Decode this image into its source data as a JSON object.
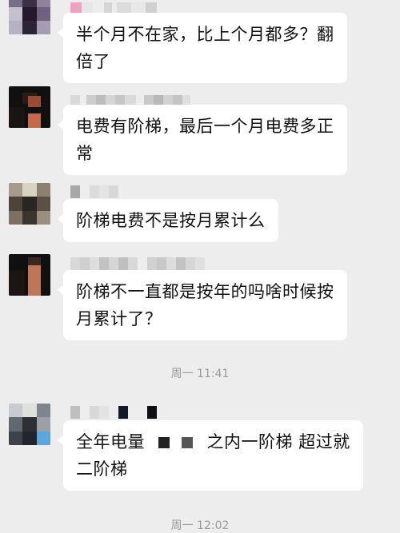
{
  "messages": [
    {
      "lines": [
        "半个月不在家，比上个月都多？翻",
        "倍了"
      ]
    },
    {
      "lines": [
        "电费有阶梯，最后一个月电费多正",
        "常"
      ]
    },
    {
      "lines": [
        "阶梯电费不是按月累计么"
      ]
    },
    {
      "lines": [
        "阶梯不一直都是按年的吗啥时候按",
        "月累计了？"
      ]
    },
    {
      "line1_pre": "全年电量",
      "line1_post": "之内一阶梯 超过就",
      "line2": "二阶梯"
    }
  ],
  "timestamps": [
    "周一 11:41",
    "周一 12:02"
  ],
  "colors": {
    "background": "#ededed",
    "bubble": "#ffffff",
    "timestamp_text": "#9a9a9a"
  }
}
